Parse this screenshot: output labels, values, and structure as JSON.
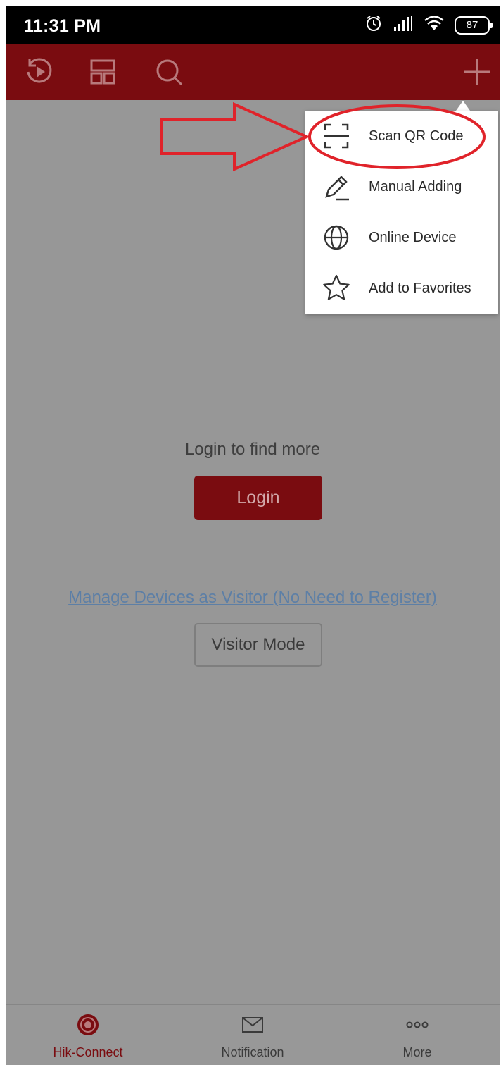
{
  "status_bar": {
    "time": "11:31 PM",
    "battery": "87",
    "icons": [
      "alarm-icon",
      "signal-icon",
      "wifi-icon",
      "battery-icon"
    ]
  },
  "toolbar": {
    "icons": [
      "playback-icon",
      "layout-icon",
      "search-icon",
      "add-icon"
    ],
    "bg_color": "#7a0c10"
  },
  "menu": {
    "items": [
      {
        "label": "Scan QR Code",
        "icon": "qr-scan-icon"
      },
      {
        "label": "Manual Adding",
        "icon": "pencil-icon"
      },
      {
        "label": "Online Device",
        "icon": "globe-icon"
      },
      {
        "label": "Add to Favorites",
        "icon": "star-icon"
      }
    ]
  },
  "main": {
    "login_hint": "Login to find more",
    "login_button": "Login",
    "visitor_link": "Manage Devices as Visitor (No Need to Register)",
    "visitor_button": "Visitor Mode"
  },
  "bottom_nav": {
    "items": [
      {
        "label": "Hik-Connect",
        "icon": "hik-connect-icon",
        "active": true
      },
      {
        "label": "Notification",
        "icon": "mail-icon",
        "active": false
      },
      {
        "label": "More",
        "icon": "more-dots-icon",
        "active": false
      }
    ]
  },
  "annotation": {
    "arrow_color": "#e0232a",
    "highlight": "Scan QR Code"
  },
  "colors": {
    "overlay": "#979797",
    "accent": "#7a0c10",
    "link": "#5d7fa6"
  }
}
